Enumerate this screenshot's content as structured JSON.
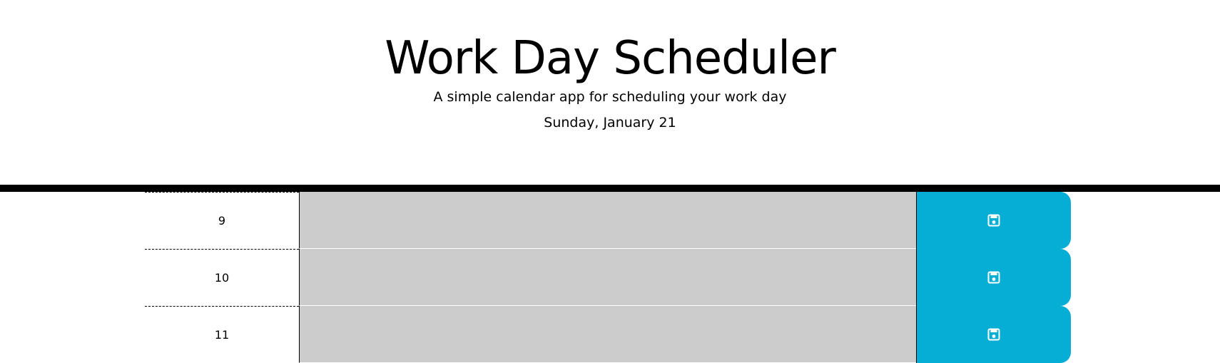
{
  "header": {
    "title": "Work Day Scheduler",
    "subtitle": "A simple calendar app for scheduling your work day",
    "current_day": "Sunday, January 21"
  },
  "time_blocks": [
    {
      "hour": "9",
      "description": "",
      "save_icon": "save-icon"
    },
    {
      "hour": "10",
      "description": "",
      "save_icon": "save-icon"
    },
    {
      "hour": "11",
      "description": "",
      "save_icon": "save-icon"
    }
  ],
  "colors": {
    "past": "#cccccc",
    "save_button": "#06aed5",
    "header_border": "#000000"
  }
}
